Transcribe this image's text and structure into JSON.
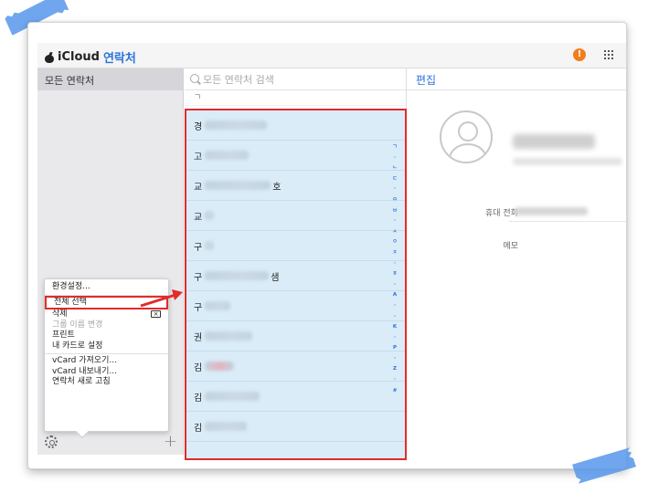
{
  "app": {
    "brand": "iCloud",
    "title": "연락처",
    "alert_badge": "!"
  },
  "sidebar": {
    "groups": [
      {
        "label": "모든 연락처"
      }
    ]
  },
  "context_menu": {
    "items": [
      {
        "label": "환경설정...",
        "disabled": false
      },
      {
        "label": "전체 선택",
        "disabled": false,
        "highlighted": true
      },
      {
        "label": "삭제",
        "disabled": false,
        "shortcut_icon": "delete-key-icon"
      },
      {
        "label": "그룹 이름 변경",
        "disabled": true
      },
      {
        "label": "프린트",
        "disabled": false
      },
      {
        "label": "내 카드로 설정",
        "disabled": false
      },
      {
        "label": "vCard 가져오기...",
        "disabled": false
      },
      {
        "label": "vCard 내보내기...",
        "disabled": false
      },
      {
        "label": "연락처 새로 고침",
        "disabled": false
      }
    ]
  },
  "contacts": {
    "search_placeholder": "모든 연락처 검색",
    "section_header": "ㄱ",
    "rows": [
      {
        "prefix": "경",
        "suffix": ""
      },
      {
        "prefix": "고",
        "suffix": ""
      },
      {
        "prefix": "교",
        "suffix": "호"
      },
      {
        "prefix": "교",
        "suffix": ""
      },
      {
        "prefix": "구",
        "suffix": ""
      },
      {
        "prefix": "구",
        "suffix": "샘"
      },
      {
        "prefix": "구",
        "suffix": ""
      },
      {
        "prefix": "권",
        "suffix": ""
      },
      {
        "prefix": "김",
        "suffix": ""
      },
      {
        "prefix": "김",
        "suffix": ""
      },
      {
        "prefix": "김",
        "suffix": ""
      }
    ],
    "alpha_index": [
      "ㄱ",
      "•",
      "ㄴ",
      "ㄷ",
      "•",
      "ㅁ",
      "ㅂ",
      "•",
      "ㅅ",
      "ㅇ",
      "ㅈ",
      "•",
      "ㅎ",
      "•",
      "A",
      "•",
      "•",
      "K",
      "•",
      "P",
      "•",
      "Z",
      "•",
      "#"
    ]
  },
  "detail": {
    "header": "편집",
    "fields": [
      {
        "label": "휴대 전화"
      },
      {
        "label": "메모"
      }
    ]
  },
  "colors": {
    "accent": "#2a73d8",
    "selection": "#d9ecf8",
    "annotation": "#e22b2b",
    "alert": "#f07f1a",
    "tape": "#5696eb"
  }
}
